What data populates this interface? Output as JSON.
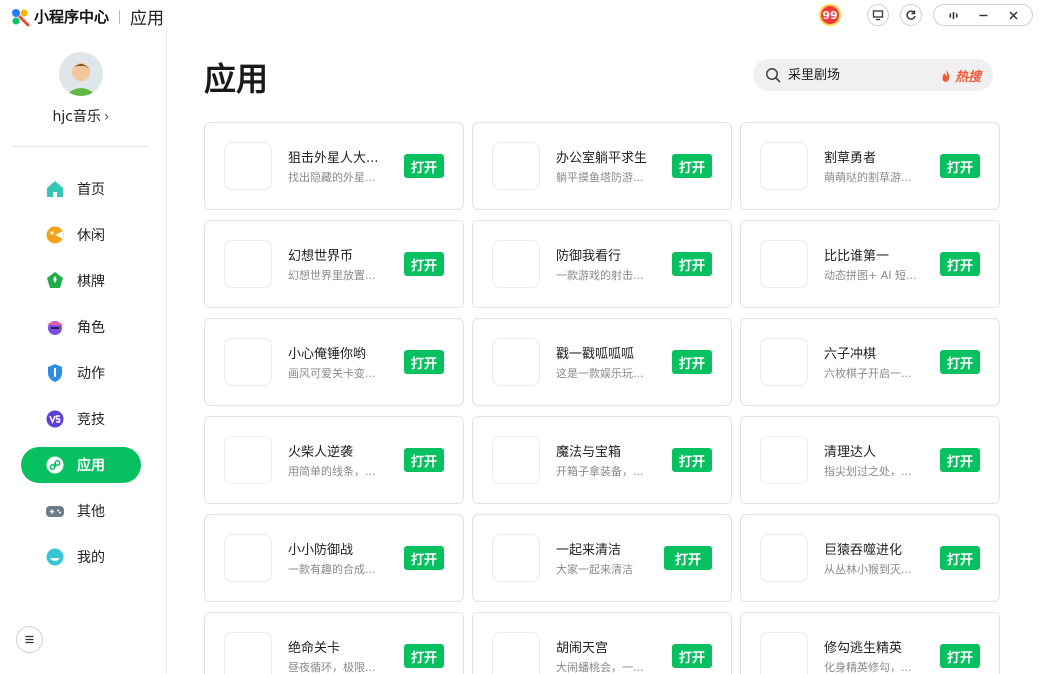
{
  "titlebar": {
    "app_name": "小程序中心",
    "section": "应用",
    "badge_count": "99"
  },
  "sidebar": {
    "username": "hjc音乐",
    "items": [
      {
        "label": "首页",
        "icon": "home-icon"
      },
      {
        "label": "休闲",
        "icon": "casual-icon"
      },
      {
        "label": "棋牌",
        "icon": "cards-icon"
      },
      {
        "label": "角色",
        "icon": "role-icon"
      },
      {
        "label": "动作",
        "icon": "action-icon"
      },
      {
        "label": "竞技",
        "icon": "versus-icon"
      },
      {
        "label": "应用",
        "icon": "app-icon",
        "active": true
      },
      {
        "label": "其他",
        "icon": "gamepad-icon"
      },
      {
        "label": "我的",
        "icon": "mine-icon"
      }
    ]
  },
  "main": {
    "title": "应用",
    "search": {
      "value": "采里剧场",
      "hot_label": "热搜"
    },
    "open_label": "打开",
    "apps": [
      {
        "name": "狙击外星人大...",
        "desc": "找出隐藏的外星..."
      },
      {
        "name": "办公室躺平求生",
        "desc": "躺平摸鱼塔防游..."
      },
      {
        "name": "割草勇者",
        "desc": "萌萌哒的割草游..."
      },
      {
        "name": "幻想世界币",
        "desc": "幻想世界里放置..."
      },
      {
        "name": "防御我看行",
        "desc": "一款游戏的射击..."
      },
      {
        "name": "比比谁第一",
        "desc": "动态拼图+ AI 短..."
      },
      {
        "name": "小心俺锤你哟",
        "desc": "画风可爱关卡变..."
      },
      {
        "name": "戳一戳呱呱呱",
        "desc": "这是一款娱乐玩..."
      },
      {
        "name": "六子冲棋",
        "desc": "六枚棋子开启一..."
      },
      {
        "name": "火柴人逆袭",
        "desc": "用简单的线条，..."
      },
      {
        "name": "魔法与宝箱",
        "desc": "开箱子拿装备，..."
      },
      {
        "name": "清理达人",
        "desc": "指尖划过之处，..."
      },
      {
        "name": "小小防御战",
        "desc": "一款有趣的合成..."
      },
      {
        "name": "一起来清洁",
        "desc": "大家一起来清洁"
      },
      {
        "name": "巨猿吞噬进化",
        "desc": "从丛林小猴到灭..."
      },
      {
        "name": "绝命关卡",
        "desc": "昼夜循环，极限..."
      },
      {
        "name": "胡闹天宫",
        "desc": "大闹蟠桃会，一..."
      },
      {
        "name": "修勾逃生精英",
        "desc": "化身精英修勾，..."
      }
    ]
  }
}
